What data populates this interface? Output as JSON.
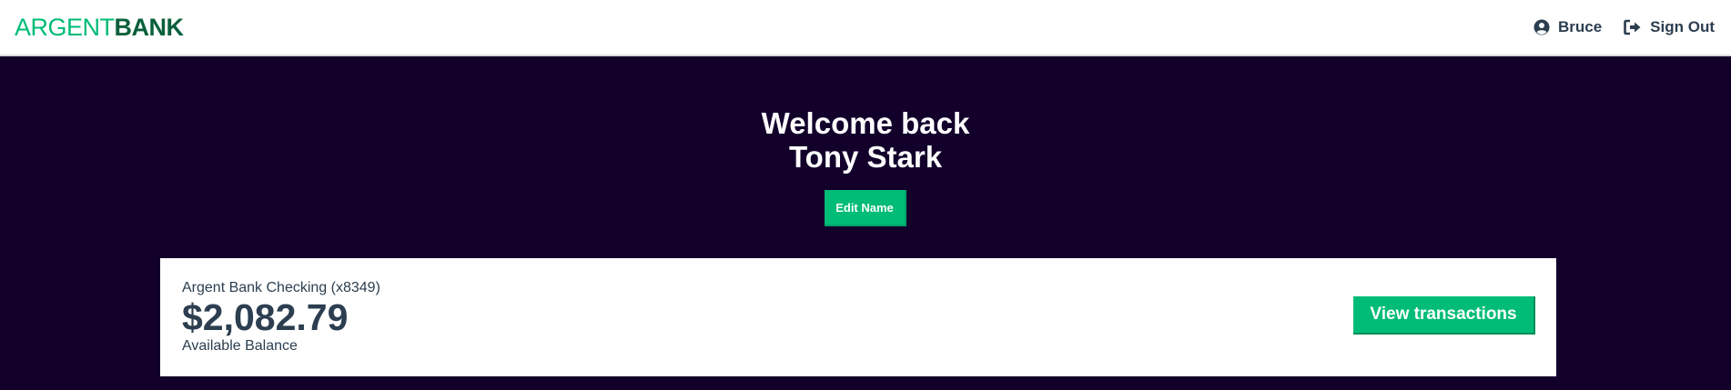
{
  "nav": {
    "logo_part1": "ARGENT",
    "logo_part2": "BANK",
    "user_label": "Bruce",
    "user_icon": "user-circle-icon",
    "signout_label": "Sign Out",
    "signout_icon": "sign-out-icon"
  },
  "header": {
    "welcome_line1": "Welcome back",
    "welcome_line2": "Tony Stark",
    "edit_label": "Edit Name"
  },
  "accounts": [
    {
      "title": "Argent Bank Checking (x8349)",
      "amount": "$2,082.79",
      "description": "Available Balance",
      "button_label": "View transactions"
    }
  ],
  "colors": {
    "brand_green": "#00bc77",
    "brand_dark_green": "#0a5f3c",
    "background": "#12002b",
    "text_dark": "#2c3e50"
  }
}
